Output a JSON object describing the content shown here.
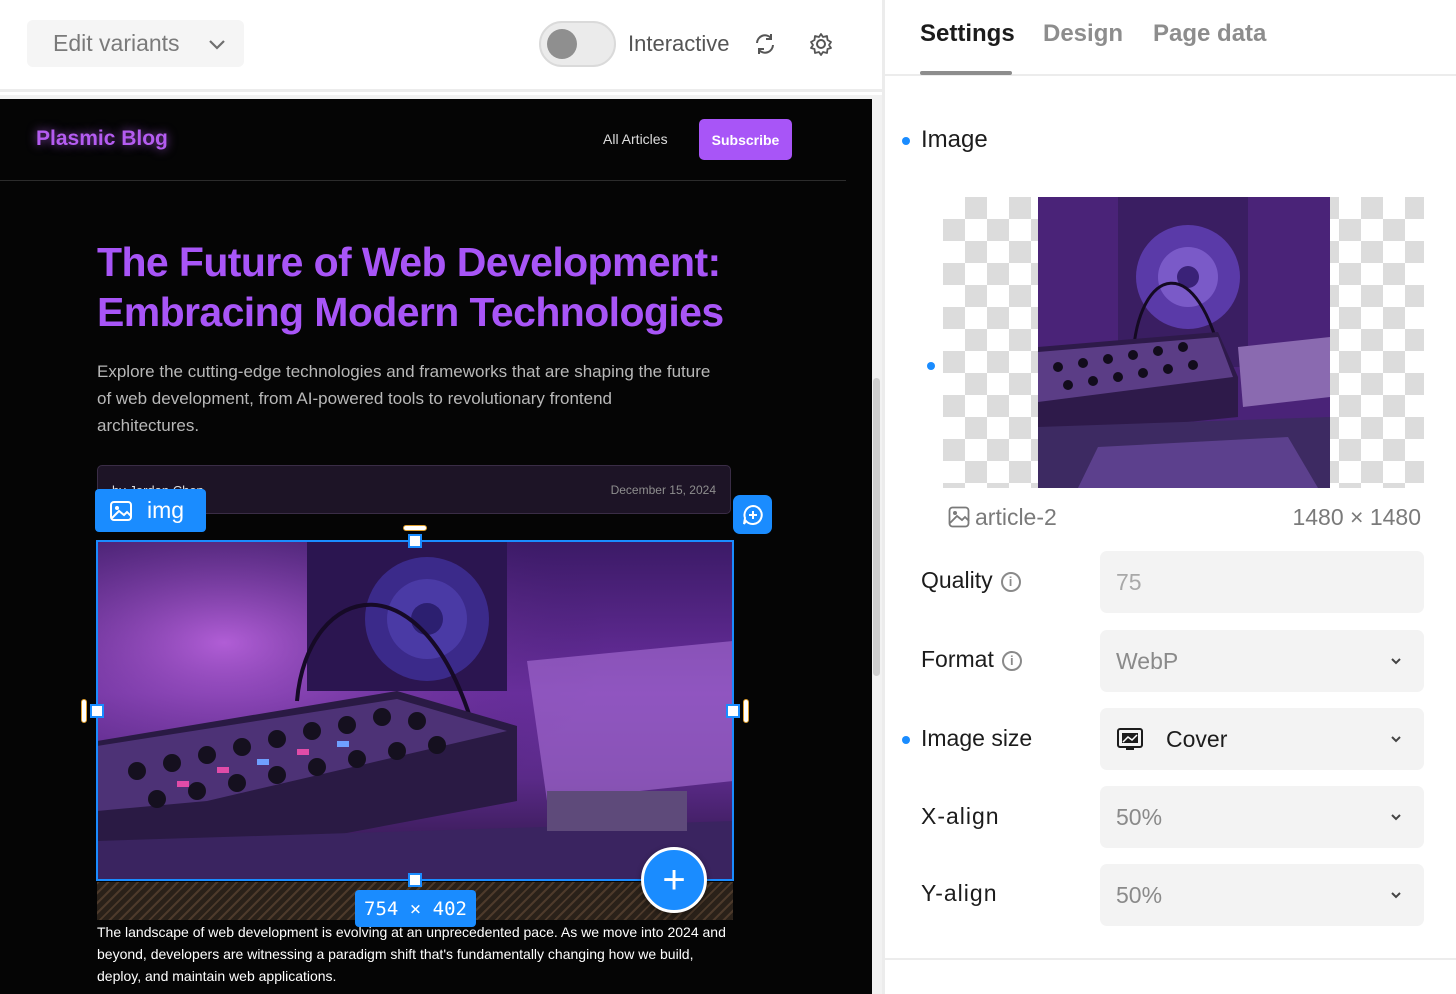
{
  "toolbar": {
    "variants_label": "Edit variants",
    "interactive_label": "Interactive",
    "interactive_on": false
  },
  "site": {
    "brand": "Plasmic Blog",
    "nav_link": "All Articles",
    "subscribe": "Subscribe",
    "headline_1": "The Future of Web Development:",
    "headline_2": "Embracing Modern Technologies",
    "lede": "Explore the cutting-edge technologies and frameworks that are shaping the future of web development, from AI-powered tools to revolutionary frontend architectures.",
    "author": "by Jordan Chen",
    "date": "December 15, 2024",
    "body": "The landscape of web development is evolving at an unprecedented pace. As we move into 2024 and beyond, developers are witnessing a paradigm shift that's fundamentally changing how we build, deploy, and maintain web applications.",
    "brand_color": "#a855f7"
  },
  "selection": {
    "tag": "img",
    "dims": "754 × 402",
    "accent": "#1a8cff"
  },
  "panel": {
    "tabs": [
      "Settings",
      "Design",
      "Page data"
    ],
    "active_tab": "Settings",
    "section_title": "Image",
    "asset_name": "article-2",
    "asset_dims": "1480 × 1480",
    "quality_label": "Quality",
    "quality_placeholder": "75",
    "format_label": "Format",
    "format_value": "WebP",
    "size_label": "Image size",
    "size_value": "Cover",
    "xalign_label": "X-align",
    "xalign_value": "50%",
    "yalign_label": "Y-align",
    "yalign_value": "50%"
  }
}
